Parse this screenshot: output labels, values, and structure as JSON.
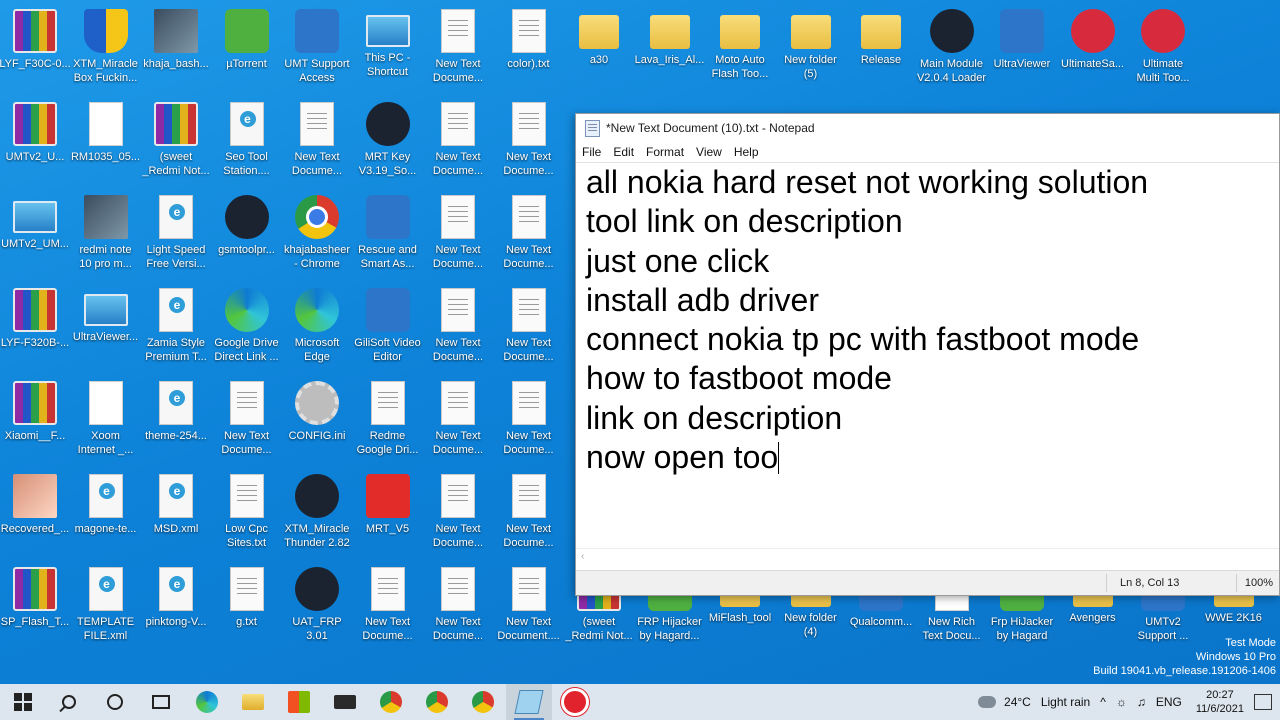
{
  "desktop_icons": [
    {
      "label": "LYF_F30C-0...",
      "icon": "winrar-icon",
      "glyph": "g-rar"
    },
    {
      "label": "XTM_Miracle\nBox Fuckin...",
      "icon": "miracle-box-icon",
      "glyph": "g-shield"
    },
    {
      "label": "khaja_bash...",
      "icon": "photo-icon",
      "glyph": "g-photo"
    },
    {
      "label": "µTorrent",
      "icon": "utorrent-icon",
      "glyph": "g-green"
    },
    {
      "label": "UMT Support\nAccess",
      "icon": "umt-support-icon",
      "glyph": "g-blue"
    },
    {
      "label": "This PC -\nShortcut",
      "icon": "this-pc-icon",
      "glyph": "g-pc"
    },
    {
      "label": "New Text\nDocume...",
      "icon": "text-file-icon",
      "glyph": "g-txt"
    },
    {
      "label": "color).txt",
      "icon": "text-file-icon",
      "glyph": "g-txt"
    },
    {
      "label": "a30",
      "icon": "folder-icon",
      "glyph": "g-folder"
    },
    {
      "label": "Lava_Iris_Al...",
      "icon": "folder-icon",
      "glyph": "g-folder"
    },
    {
      "label": "Moto Auto\nFlash Too...",
      "icon": "folder-icon",
      "glyph": "g-folder"
    },
    {
      "label": "New folder\n(5)",
      "icon": "folder-icon",
      "glyph": "g-folder"
    },
    {
      "label": "Release",
      "icon": "folder-icon",
      "glyph": "g-folder"
    },
    {
      "label": "Main Module\nV2.0.4 Loader",
      "icon": "tfm-tool-icon",
      "glyph": "g-dark"
    },
    {
      "label": "UltraViewer",
      "icon": "ultraviewer-icon",
      "glyph": "g-blue"
    },
    {
      "label": "UltimateSa...",
      "icon": "ultimate-icon",
      "glyph": "g-red"
    },
    {
      "label": "Ultimate\nMulti Too...",
      "icon": "ultimate-multi-tool-icon",
      "glyph": "g-red"
    },
    {
      "label": "UMTv2_U...",
      "icon": "winrar-icon",
      "glyph": "g-rar"
    },
    {
      "label": "RM1035_05...",
      "icon": "file-icon",
      "glyph": "g-white"
    },
    {
      "label": "(sweet\n_Redmi Not...",
      "icon": "winrar-icon",
      "glyph": "g-rar"
    },
    {
      "label": "Seo Tool\nStation....",
      "icon": "html-file-icon",
      "glyph": "g-html"
    },
    {
      "label": "New Text\nDocume...",
      "icon": "text-file-icon",
      "glyph": "g-txt"
    },
    {
      "label": "MRT Key\nV3.19_So...",
      "icon": "mrt-key-icon",
      "glyph": "g-dark"
    },
    {
      "label": "New Text\nDocume...",
      "icon": "text-file-icon",
      "glyph": "g-txt"
    },
    {
      "label": "New Text\nDocume...",
      "icon": "text-file-icon",
      "glyph": "g-txt"
    },
    {
      "label": "UMTv2_UM...",
      "icon": "installer-icon",
      "glyph": "g-pc"
    },
    {
      "label": "redmi note\n10 pro m...",
      "icon": "photo-icon",
      "glyph": "g-photo"
    },
    {
      "label": "Light Speed\nFree Versi...",
      "icon": "html-file-icon",
      "glyph": "g-html"
    },
    {
      "label": "gsmtoolpr...",
      "icon": "gtp-icon",
      "glyph": "g-dark"
    },
    {
      "label": "khajabasheer\n- Chrome",
      "icon": "chrome-icon",
      "glyph": "g-chrome"
    },
    {
      "label": "Rescue and\nSmart As...",
      "icon": "rescue-smart-icon",
      "glyph": "g-blue"
    },
    {
      "label": "New Text\nDocume...",
      "icon": "text-file-icon",
      "glyph": "g-txt"
    },
    {
      "label": "New Text\nDocume...",
      "icon": "text-file-icon",
      "glyph": "g-txt"
    },
    {
      "label": "LYF-F320B-...",
      "icon": "winrar-icon",
      "glyph": "g-rar"
    },
    {
      "label": "UltraViewer...",
      "icon": "installer-icon",
      "glyph": "g-pc"
    },
    {
      "label": "Zamia Style\nPremium T...",
      "icon": "html-file-icon",
      "glyph": "g-html"
    },
    {
      "label": "Google Drive\nDirect Link ...",
      "icon": "edge-icon",
      "glyph": "g-edge"
    },
    {
      "label": "Microsoft\nEdge",
      "icon": "edge-icon",
      "glyph": "g-edge"
    },
    {
      "label": "GiliSoft Video\nEditor",
      "icon": "video-editor-icon",
      "glyph": "g-blue"
    },
    {
      "label": "New Text\nDocume...",
      "icon": "text-file-icon",
      "glyph": "g-txt"
    },
    {
      "label": "New Text\nDocume...",
      "icon": "text-file-icon",
      "glyph": "g-txt"
    },
    {
      "label": "Xiaomi__F...",
      "icon": "winrar-icon",
      "glyph": "g-rar"
    },
    {
      "label": "Xoom\nInternet _...",
      "icon": "xoom-icon",
      "glyph": "g-white"
    },
    {
      "label": "theme-254...",
      "icon": "html-file-icon",
      "glyph": "g-html"
    },
    {
      "label": "New Text\nDocume...",
      "icon": "text-file-icon",
      "glyph": "g-txt"
    },
    {
      "label": "CONFIG.ini",
      "icon": "settings-file-icon",
      "glyph": "g-gear"
    },
    {
      "label": "Redme\nGoogle Dri...",
      "icon": "text-file-icon",
      "glyph": "g-txt"
    },
    {
      "label": "New Text\nDocume...",
      "icon": "text-file-icon",
      "glyph": "g-txt"
    },
    {
      "label": "New Text\nDocume...",
      "icon": "text-file-icon",
      "glyph": "g-txt"
    },
    {
      "label": "Recovered_...",
      "icon": "photo-icon",
      "glyph": "g-photo2"
    },
    {
      "label": "magone-te...",
      "icon": "html-file-icon",
      "glyph": "g-html"
    },
    {
      "label": "MSD.xml",
      "icon": "html-file-icon",
      "glyph": "g-html"
    },
    {
      "label": "Low Cpc\nSites.txt",
      "icon": "text-file-icon",
      "glyph": "g-txt"
    },
    {
      "label": "XTM_Miracle\nThunder 2.82",
      "icon": "gsm-team-icon",
      "glyph": "g-dark"
    },
    {
      "label": "MRT_V5",
      "icon": "mrt-icon",
      "glyph": "g-mri"
    },
    {
      "label": "New Text\nDocume...",
      "icon": "text-file-icon",
      "glyph": "g-txt"
    },
    {
      "label": "New Text\nDocume...",
      "icon": "text-file-icon",
      "glyph": "g-txt"
    },
    {
      "label": "SP_Flash_T...",
      "icon": "winrar-icon",
      "glyph": "g-rar"
    },
    {
      "label": "TEMPLATE\nFILE.xml",
      "icon": "html-file-icon",
      "glyph": "g-html"
    },
    {
      "label": "pinktong-V...",
      "icon": "html-file-icon",
      "glyph": "g-html"
    },
    {
      "label": "g.txt",
      "icon": "text-file-icon",
      "glyph": "g-txt"
    },
    {
      "label": "UAT_FRP 3.01",
      "icon": "uat-icon",
      "glyph": "g-dark"
    },
    {
      "label": "New Text\nDocume...",
      "icon": "text-file-icon",
      "glyph": "g-txt"
    },
    {
      "label": "New Text\nDocume...",
      "icon": "text-file-icon",
      "glyph": "g-txt"
    },
    {
      "label": "New Text\nDocument....",
      "icon": "text-file-icon",
      "glyph": "g-txt"
    },
    {
      "label": "(sweet\n_Redmi Not...",
      "icon": "winrar-icon",
      "glyph": "g-rar"
    },
    {
      "label": "FRP Hijacker\nby Hagard...",
      "icon": "frp-hijacker-icon",
      "glyph": "g-green"
    },
    {
      "label": "MiFlash_tool",
      "icon": "folder-icon",
      "glyph": "g-folder"
    },
    {
      "label": "New folder\n(4)",
      "icon": "folder-icon",
      "glyph": "g-folder"
    },
    {
      "label": "Qualcomm...",
      "icon": "qualcomm-icon",
      "glyph": "g-blue"
    },
    {
      "label": "New Rich\nText Docu...",
      "icon": "rich-text-icon",
      "glyph": "g-white"
    },
    {
      "label": "Frp HiJacker\nby Hagard",
      "icon": "frp-hijacker-icon",
      "glyph": "g-green"
    },
    {
      "label": "Avengers",
      "icon": "folder-icon",
      "glyph": "g-folder"
    },
    {
      "label": "UMTv2\nSupport ...",
      "icon": "umt-support-icon",
      "glyph": "g-blue"
    },
    {
      "label": "WWE 2K16",
      "icon": "folder-icon",
      "glyph": "g-folder"
    }
  ],
  "notepad": {
    "title": "*New Text Document (10).txt - Notepad",
    "menu": [
      "File",
      "Edit",
      "Format",
      "View",
      "Help"
    ],
    "lines": [
      "all nokia hard reset not working solution",
      "tool link on description",
      "just one click",
      "install adb driver",
      "connect nokia tp pc with fastboot mode",
      "how to fastboot mode",
      "link on description",
      "now open too"
    ],
    "status_position": "Ln 8, Col 13",
    "status_zoom": "100%"
  },
  "watermark": {
    "line1": "Test Mode",
    "line2": "Windows 10 Pro",
    "line3": "Build 19041.vb_release.191206-1406"
  },
  "taskbar": {
    "apps": [
      {
        "name": "start-button",
        "glyph": "tb-win"
      },
      {
        "name": "search-button",
        "glyph": "tb-search"
      },
      {
        "name": "cortana-button",
        "glyph": "tb-circle"
      },
      {
        "name": "task-view-button",
        "glyph": "tb-view"
      },
      {
        "name": "taskbar-edge",
        "glyph": "tb-edge"
      },
      {
        "name": "taskbar-file-explorer",
        "glyph": "tb-folder"
      },
      {
        "name": "taskbar-store",
        "glyph": "tb-store"
      },
      {
        "name": "taskbar-mail",
        "glyph": "tb-mail"
      },
      {
        "name": "taskbar-chrome-1",
        "glyph": "tb-chrome"
      },
      {
        "name": "taskbar-chrome-2",
        "glyph": "tb-chrome"
      },
      {
        "name": "taskbar-chrome-3",
        "glyph": "tb-chrome"
      },
      {
        "name": "taskbar-notepad",
        "glyph": "tb-notepad",
        "active": true
      },
      {
        "name": "taskbar-red-app",
        "glyph": "tb-red"
      }
    ],
    "weather_temp": "24°C",
    "weather_text": "Light rain",
    "tray_chevron": "^",
    "language": "ENG",
    "time": "20:27",
    "date": "11/6/2021"
  },
  "colors": {
    "desktop_bg": "#0d82d8",
    "taskbar_bg": "#dde6ee"
  }
}
